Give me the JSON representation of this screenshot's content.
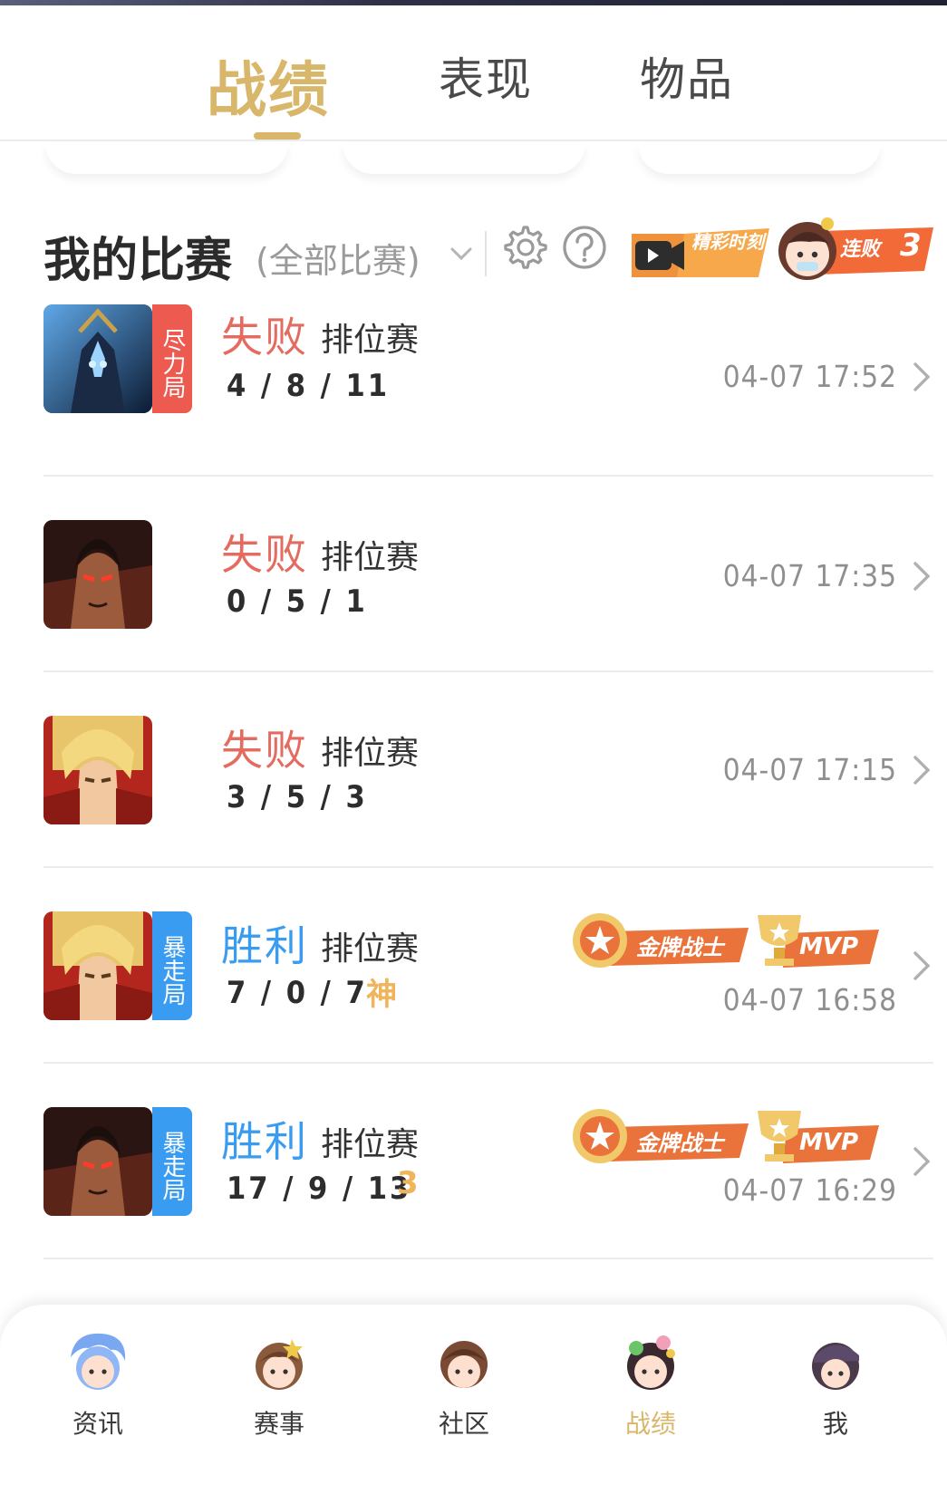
{
  "tabs": [
    {
      "label": "战绩",
      "active": true
    },
    {
      "label": "表现",
      "active": false
    },
    {
      "label": "物品",
      "active": false
    }
  ],
  "header": {
    "title": "我的比赛",
    "filter": "(全部比赛)",
    "settings_icon": "gear-icon",
    "help_icon": "question-icon",
    "highlight_label": "精彩时刻",
    "streak_label": "连败",
    "streak_count": "3"
  },
  "matches": [
    {
      "result": "失败",
      "mode": "排位赛",
      "kda": "4 / 8 / 11",
      "tag": "尽力局",
      "time": "04-07 17:52",
      "kind": "loss"
    },
    {
      "result": "失败",
      "mode": "排位赛",
      "kda": "0 / 5 / 1",
      "tag": "",
      "time": "04-07 17:35",
      "kind": "loss"
    },
    {
      "result": "失败",
      "mode": "排位赛",
      "kda": "3 / 5 / 3",
      "tag": "",
      "time": "04-07 17:15",
      "kind": "loss"
    },
    {
      "result": "胜利",
      "mode": "排位赛",
      "kda": "7 / 0 / 7",
      "kda_badge": "神",
      "tag": "暴走局",
      "time": "04-07 16:58",
      "kind": "win",
      "medals": [
        "金牌战士",
        "MVP"
      ]
    },
    {
      "result": "胜利",
      "mode": "排位赛",
      "kda": "17 / 9 / 13",
      "kda_badge": "3",
      "tag": "暴走局",
      "time": "04-07 16:29",
      "kind": "win",
      "medals": [
        "金牌战士",
        "MVP"
      ]
    }
  ],
  "bottom_nav": [
    {
      "label": "资讯",
      "active": false
    },
    {
      "label": "赛事",
      "active": false
    },
    {
      "label": "社区",
      "active": false
    },
    {
      "label": "战绩",
      "active": true
    },
    {
      "label": "我",
      "active": false
    }
  ],
  "colors": {
    "accent_gold": "#d8b66a",
    "loss_red": "#e46b60",
    "win_blue": "#3a9cf0",
    "tag_red": "#ec5a50",
    "tag_blue": "#3a9cf0",
    "badge_orange": "#f26a38"
  }
}
